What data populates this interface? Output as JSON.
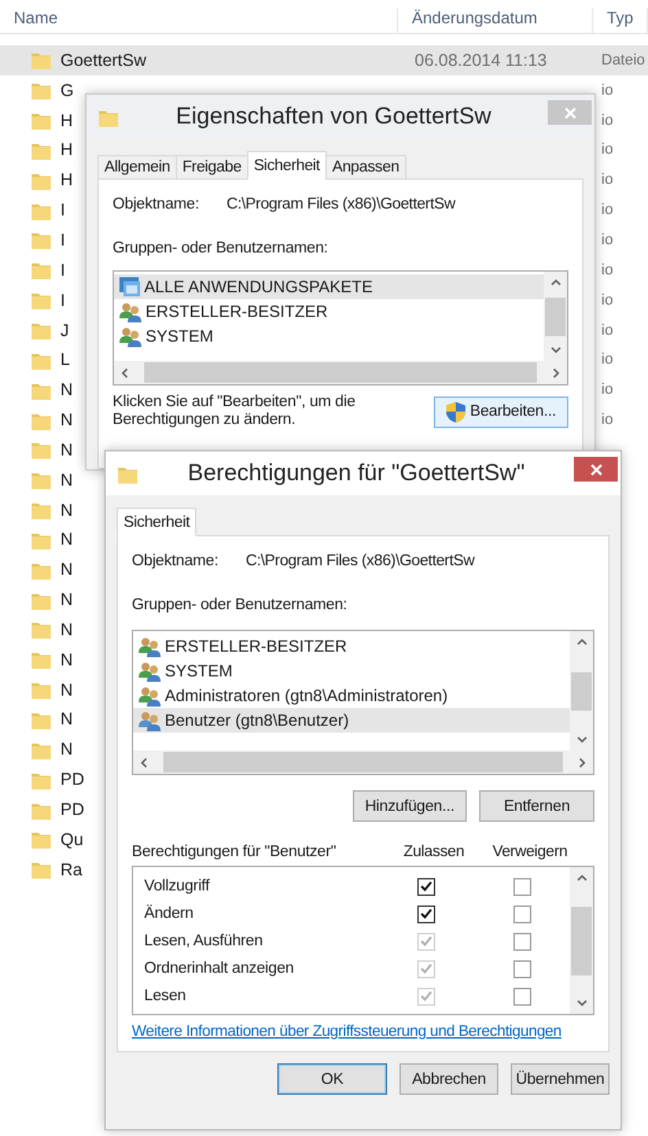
{
  "explorer": {
    "columns": [
      "Name",
      "Änderungsdatum",
      "Typ"
    ],
    "rows": [
      {
        "name": "GoettertSw",
        "date": "06.08.2014 11:13",
        "type": "Dateio",
        "selected": true
      },
      {
        "name": "G",
        "type": "io",
        "selected": false
      },
      {
        "name": "H",
        "type": "io",
        "selected": false
      },
      {
        "name": "H",
        "type": "io",
        "selected": false
      },
      {
        "name": "H",
        "type": "io",
        "selected": false
      },
      {
        "name": "I",
        "type": "io",
        "selected": false
      },
      {
        "name": "I",
        "type": "io",
        "selected": false
      },
      {
        "name": "I",
        "type": "io",
        "selected": false
      },
      {
        "name": "I",
        "type": "io",
        "selected": false
      },
      {
        "name": "J",
        "type": "io",
        "selected": false
      },
      {
        "name": "L",
        "type": "io",
        "selected": false
      },
      {
        "name": "N",
        "type": "io",
        "selected": false
      },
      {
        "name": "N",
        "type": "io",
        "selected": false
      },
      {
        "name": "N",
        "selected": false
      },
      {
        "name": "N",
        "selected": false
      },
      {
        "name": "N",
        "selected": false
      },
      {
        "name": "N",
        "selected": false
      },
      {
        "name": "N",
        "selected": false
      },
      {
        "name": "N",
        "selected": false
      },
      {
        "name": "N",
        "selected": false
      },
      {
        "name": "N",
        "selected": false
      },
      {
        "name": "N",
        "selected": false
      },
      {
        "name": "N",
        "selected": false
      },
      {
        "name": "N",
        "selected": false
      },
      {
        "name": "PD",
        "selected": false
      },
      {
        "name": "PD",
        "selected": false
      },
      {
        "name": "Qu",
        "selected": false
      },
      {
        "name": "Ra",
        "selected": false
      }
    ]
  },
  "properties_dialog": {
    "title": "Eigenschaften von GoettertSw",
    "tabs": [
      {
        "label": "Allgemein",
        "selected": false
      },
      {
        "label": "Freigabe",
        "selected": false
      },
      {
        "label": "Sicherheit",
        "selected": true
      },
      {
        "label": "Anpassen",
        "selected": false
      }
    ],
    "object_label": "Objektname:",
    "object_value": "C:\\Program Files (x86)\\GoettertSw",
    "groups_label": "Gruppen- oder Benutzernamen:",
    "principals": [
      {
        "name": "ALLE ANWENDUNGSPAKETE",
        "kind": "package",
        "selected": true
      },
      {
        "name": "ERSTELLER-BESITZER",
        "kind": "group",
        "selected": false
      },
      {
        "name": "SYSTEM",
        "kind": "group",
        "selected": false
      }
    ],
    "hint": "Klicken Sie auf \"Bearbeiten\", um die Berechtigungen zu ändern.",
    "edit_button": "Bearbeiten..."
  },
  "permissions_dialog": {
    "title": "Berechtigungen für \"GoettertSw\"",
    "tabs": [
      {
        "label": "Sicherheit",
        "selected": true
      }
    ],
    "object_label": "Objektname:",
    "object_value": "C:\\Program Files (x86)\\GoettertSw",
    "groups_label": "Gruppen- oder Benutzernamen:",
    "principals": [
      {
        "name": "ERSTELLER-BESITZER",
        "kind": "group",
        "selected": false
      },
      {
        "name": "SYSTEM",
        "kind": "group",
        "selected": false
      },
      {
        "name": "Administratoren (gtn8\\Administratoren)",
        "kind": "group",
        "selected": false
      },
      {
        "name": "Benutzer (gtn8\\Benutzer)",
        "kind": "users",
        "selected": true
      }
    ],
    "add_button": "Hinzufügen...",
    "remove_button": "Entfernen",
    "perm_label": "Berechtigungen für \"Benutzer\"",
    "allow_label": "Zulassen",
    "deny_label": "Verweigern",
    "permissions": [
      {
        "name": "Vollzugriff",
        "allow": true,
        "allow_disabled": false,
        "deny": false
      },
      {
        "name": "Ändern",
        "allow": true,
        "allow_disabled": false,
        "deny": false
      },
      {
        "name": "Lesen, Ausführen",
        "allow": true,
        "allow_disabled": true,
        "deny": false
      },
      {
        "name": "Ordnerinhalt anzeigen",
        "allow": true,
        "allow_disabled": true,
        "deny": false
      },
      {
        "name": "Lesen",
        "allow": true,
        "allow_disabled": true,
        "deny": false
      }
    ],
    "link": "Weitere Informationen über Zugriffssteuerung und Berechtigungen",
    "buttons": [
      "OK",
      "Abbrechen",
      "Übernehmen"
    ]
  }
}
